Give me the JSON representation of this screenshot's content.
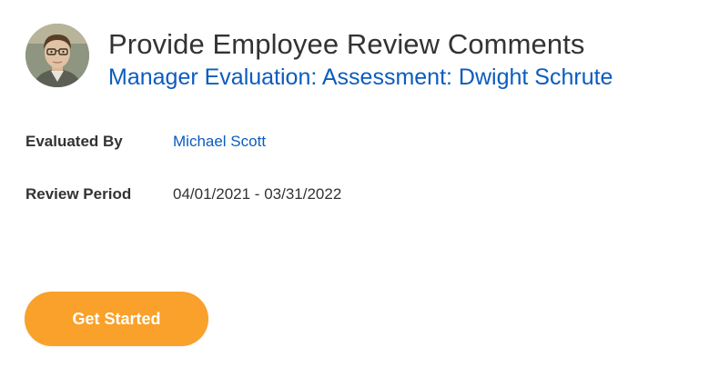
{
  "header": {
    "title": "Provide Employee Review Comments",
    "subtitle": "Manager Evaluation: Assessment: Dwight Schrute",
    "avatar_icon": "employee-photo"
  },
  "fields": {
    "evaluated_by": {
      "label": "Evaluated By",
      "value": "Michael Scott"
    },
    "review_period": {
      "label": "Review Period",
      "value": "04/01/2021 - 03/31/2022"
    }
  },
  "actions": {
    "get_started_label": "Get Started"
  },
  "colors": {
    "link": "#0b5cbf",
    "primary_button": "#f9a12a",
    "text": "#333333"
  }
}
